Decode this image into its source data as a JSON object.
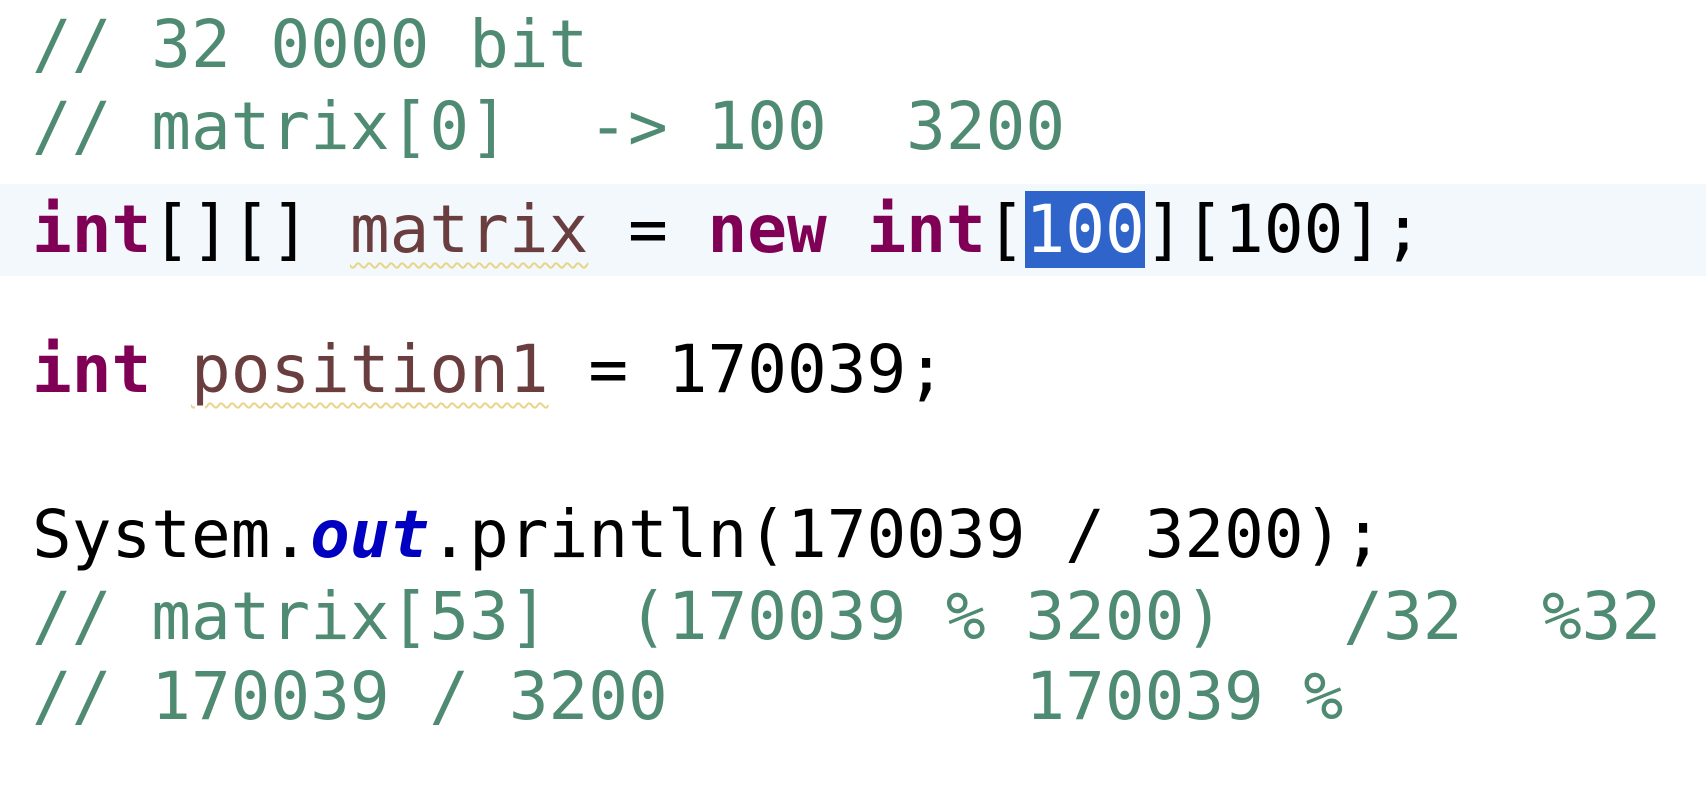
{
  "editor": {
    "lines": {
      "l1": {
        "comment": "// 32 0000 bit"
      },
      "l2": {
        "comment": "// matrix[0]  -> 100  3200"
      },
      "l3": {
        "kw_type": "int",
        "brackets": "[][] ",
        "var_name": "matrix",
        "assign": " = ",
        "kw_new": "new",
        "space": " ",
        "kw_type2": "int",
        "open": "[",
        "selected_value": "100",
        "rest": "][100];"
      },
      "l4": {
        "kw_type": "int",
        "space": " ",
        "var_name": "position1",
        "rest": " = 170039;"
      },
      "l5": {
        "prefix": "System.",
        "field": "out",
        "rest": ".println(170039 / 3200);"
      },
      "l6": {
        "comment": "// matrix[53]  (170039 % 3200)   /32  %32"
      },
      "l7": {
        "comment": "// 170039 / 3200         170039 %"
      }
    },
    "colors": {
      "comment": "#4f8a72",
      "keyword": "#7f0055",
      "static_field": "#0000c0",
      "local_variable": "#6a3e3e",
      "selection": "#2f65ca",
      "current_line": "#f2f8fb"
    }
  }
}
